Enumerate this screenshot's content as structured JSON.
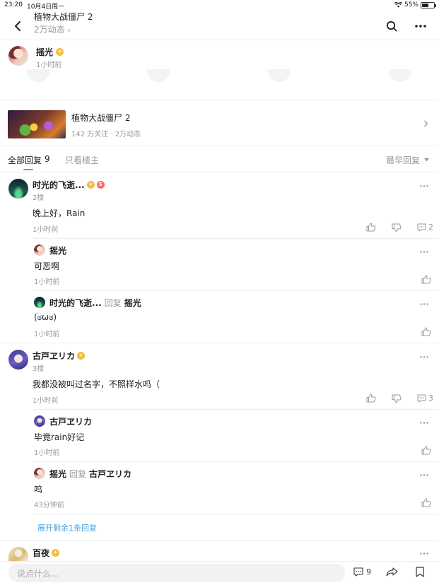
{
  "status_bar": {
    "time": "23:20",
    "date": "10月4日周一",
    "battery": "55%"
  },
  "header": {
    "title": "植物大战僵尸 2",
    "subtitle": "2万动态"
  },
  "post": {
    "author": "摇光",
    "time": "1小时前"
  },
  "forum": {
    "name": "植物大战僵尸 2",
    "stats": "142 万关注 · 2万动态"
  },
  "tabs": {
    "all_label": "全部回复",
    "all_count": "9",
    "owner_only": "只看楼主",
    "sort": "最早回复"
  },
  "comments": [
    {
      "author": "时光的飞逝...",
      "floor": "2楼",
      "text": "晚上好，Rain",
      "time": "1小时前",
      "reply_count": "2",
      "replies": [
        {
          "author": "摇光",
          "text": "可恶啊",
          "time": "1小时前"
        },
        {
          "author": "时光的飞逝...",
          "reply_word": "回复",
          "target": "摇光",
          "text": "(ಠωಠ)",
          "time": "1小时前"
        }
      ]
    },
    {
      "author": "古戸ヱリカ",
      "floor": "3楼",
      "text": "我都没被叫过名字，不照样水吗（",
      "time": "1小时前",
      "reply_count": "3",
      "replies": [
        {
          "author": "古戸ヱリカ",
          "text": "毕竟rain好记",
          "time": "1小时前"
        },
        {
          "author": "摇光",
          "reply_word": "回复",
          "target": "古戸ヱリカ",
          "text": "呜",
          "time": "43分钟前"
        }
      ],
      "expand": "展开剩余1条回复"
    },
    {
      "author": "百夜"
    }
  ],
  "bottom_bar": {
    "placeholder": "说点什么...",
    "comment_count": "9"
  },
  "icons": {
    "back": "chevron-left-icon",
    "search": "search-icon",
    "more": "more-dots-icon",
    "like": "thumbs-up-icon",
    "dislike": "thumbs-down-icon",
    "comment": "comment-icon",
    "share": "share-icon",
    "bookmark": "bookmark-icon"
  }
}
